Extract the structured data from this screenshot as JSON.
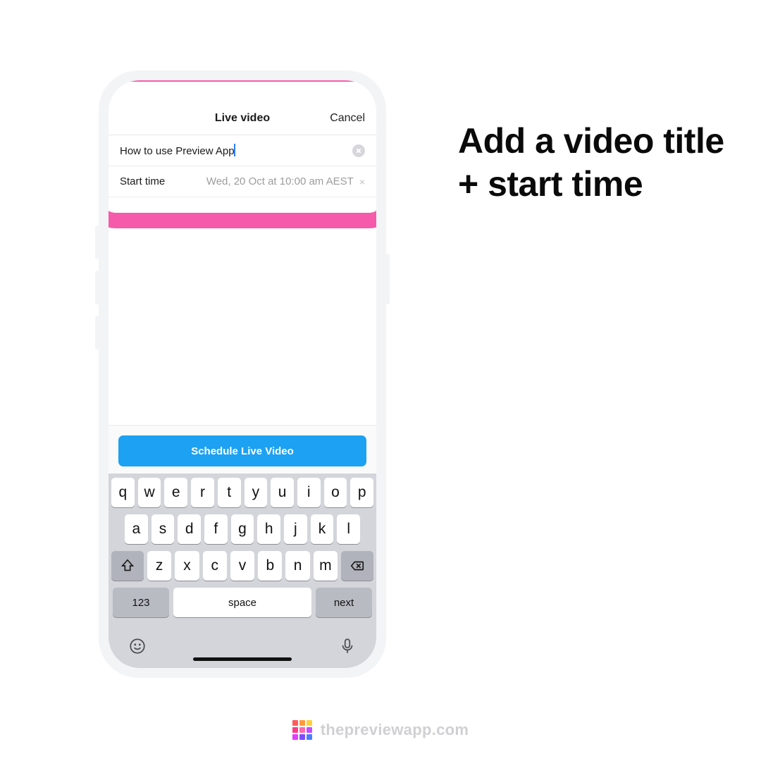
{
  "headline": "Add a video title + start time",
  "navbar": {
    "title": "Live video",
    "cancel": "Cancel"
  },
  "title_row": {
    "value": "How to use Preview App"
  },
  "start_row": {
    "label": "Start time",
    "value": "Wed, 20 Oct at 10:00 am AEST"
  },
  "primary_button": "Schedule Live Video",
  "keyboard": {
    "row1": [
      "q",
      "w",
      "e",
      "r",
      "t",
      "y",
      "u",
      "i",
      "o",
      "p"
    ],
    "row2": [
      "a",
      "s",
      "d",
      "f",
      "g",
      "h",
      "j",
      "k",
      "l"
    ],
    "row3": [
      "z",
      "x",
      "c",
      "v",
      "b",
      "n",
      "m"
    ],
    "num": "123",
    "space": "space",
    "next": "next"
  },
  "watermark": "thepreviewapp.com"
}
